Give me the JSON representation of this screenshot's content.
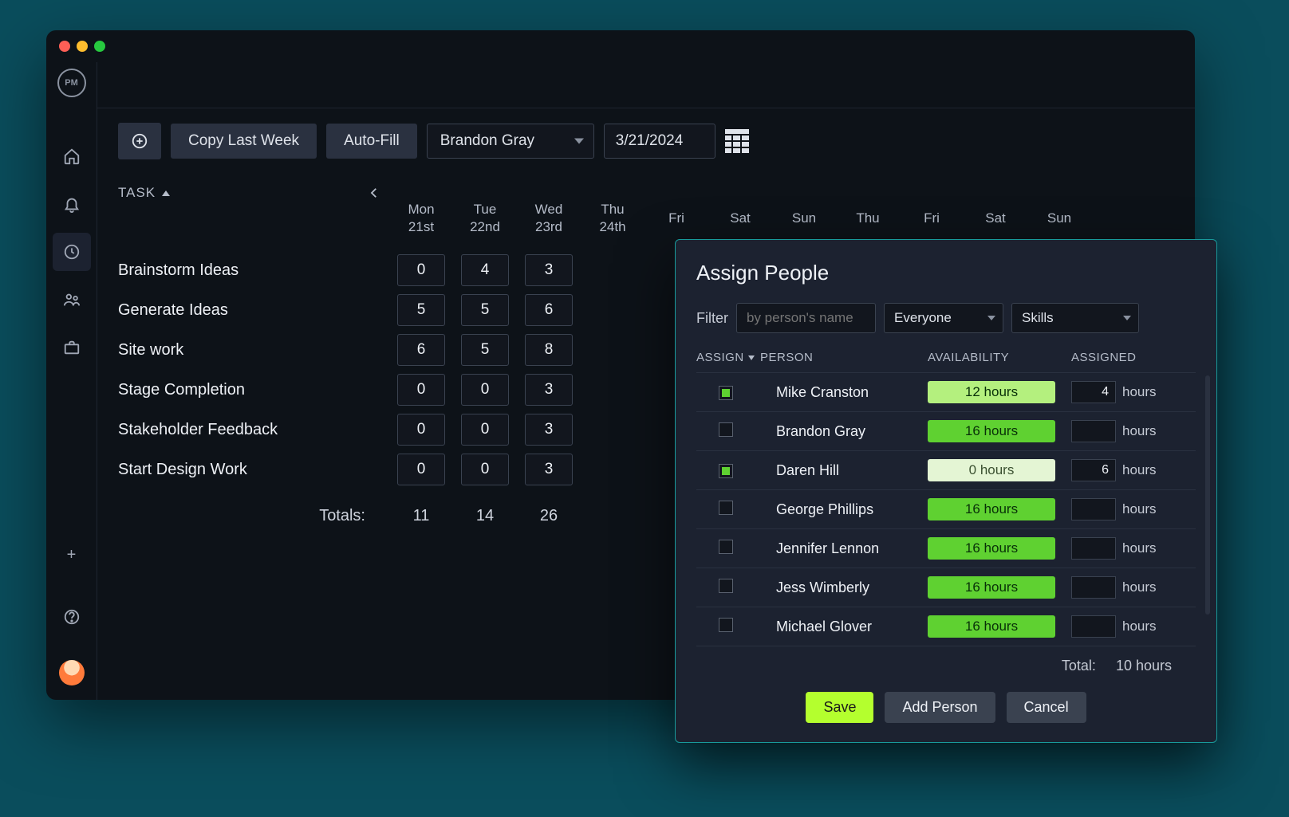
{
  "logo": "PM",
  "toolbar": {
    "copy_label": "Copy Last Week",
    "autofill_label": "Auto-Fill",
    "person_select": "Brandon Gray",
    "date": "3/21/2024"
  },
  "grid": {
    "task_header": "TASK",
    "totals_label": "Totals:",
    "days": [
      {
        "dow": "Mon",
        "date": "21st"
      },
      {
        "dow": "Tue",
        "date": "22nd"
      },
      {
        "dow": "Wed",
        "date": "23rd"
      },
      {
        "dow": "Thu",
        "date": "24th"
      },
      {
        "dow": "Fri",
        "date": ""
      },
      {
        "dow": "Sat",
        "date": ""
      },
      {
        "dow": "Sun",
        "date": ""
      },
      {
        "dow": "Thu",
        "date": ""
      },
      {
        "dow": "Fri",
        "date": ""
      },
      {
        "dow": "Sat",
        "date": ""
      },
      {
        "dow": "Sun",
        "date": ""
      }
    ],
    "tasks": [
      {
        "name": "Brainstorm Ideas",
        "cells": [
          "0",
          "4",
          "3"
        ]
      },
      {
        "name": "Generate Ideas",
        "cells": [
          "5",
          "5",
          "6"
        ]
      },
      {
        "name": "Site work",
        "cells": [
          "6",
          "5",
          "8"
        ]
      },
      {
        "name": "Stage Completion",
        "cells": [
          "0",
          "0",
          "3"
        ]
      },
      {
        "name": "Stakeholder Feedback",
        "cells": [
          "0",
          "0",
          "3"
        ]
      },
      {
        "name": "Start Design Work",
        "cells": [
          "0",
          "0",
          "3"
        ]
      }
    ],
    "totals": [
      "11",
      "14",
      "26"
    ]
  },
  "dialog": {
    "title": "Assign People",
    "filter_label": "Filter",
    "filter_placeholder": "by person's name",
    "scope_select": "Everyone",
    "skills_select": "Skills",
    "col_assign": "ASSIGN",
    "col_person": "PERSON",
    "col_availability": "AVAILABILITY",
    "col_assigned": "ASSIGNED",
    "hours_unit": "hours",
    "people": [
      {
        "checked": true,
        "name": "Mike Cranston",
        "availability": "12 hours",
        "avail_class": "avail-light",
        "assigned": "4"
      },
      {
        "checked": false,
        "name": "Brandon Gray",
        "availability": "16 hours",
        "avail_class": "avail-green",
        "assigned": ""
      },
      {
        "checked": true,
        "name": "Daren Hill",
        "availability": "0 hours",
        "avail_class": "avail-pale",
        "assigned": "6"
      },
      {
        "checked": false,
        "name": "George Phillips",
        "availability": "16 hours",
        "avail_class": "avail-green",
        "assigned": ""
      },
      {
        "checked": false,
        "name": "Jennifer Lennon",
        "availability": "16 hours",
        "avail_class": "avail-green",
        "assigned": ""
      },
      {
        "checked": false,
        "name": "Jess Wimberly",
        "availability": "16 hours",
        "avail_class": "avail-green",
        "assigned": ""
      },
      {
        "checked": false,
        "name": "Michael Glover",
        "availability": "16 hours",
        "avail_class": "avail-green",
        "assigned": ""
      }
    ],
    "total_label": "Total:",
    "total_value": "10 hours",
    "save_label": "Save",
    "add_person_label": "Add Person",
    "cancel_label": "Cancel"
  }
}
